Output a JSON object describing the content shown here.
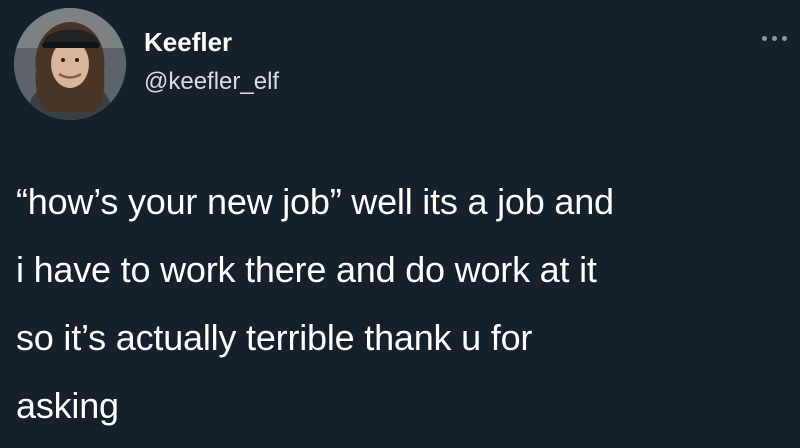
{
  "tweet": {
    "author": {
      "display_name": "Keefler",
      "handle": "@keefler_elf"
    },
    "more_icon": "more-horizontal-icon",
    "text_lines": [
      "“how’s your new job” well its a job and",
      "i have to work there and do work at it",
      "so it’s actually terrible thank u for",
      "asking"
    ]
  },
  "colors": {
    "background": "#15202b",
    "text_primary": "#ffffff",
    "text_secondary": "#d9dde0",
    "icon_muted": "#8899a6"
  }
}
